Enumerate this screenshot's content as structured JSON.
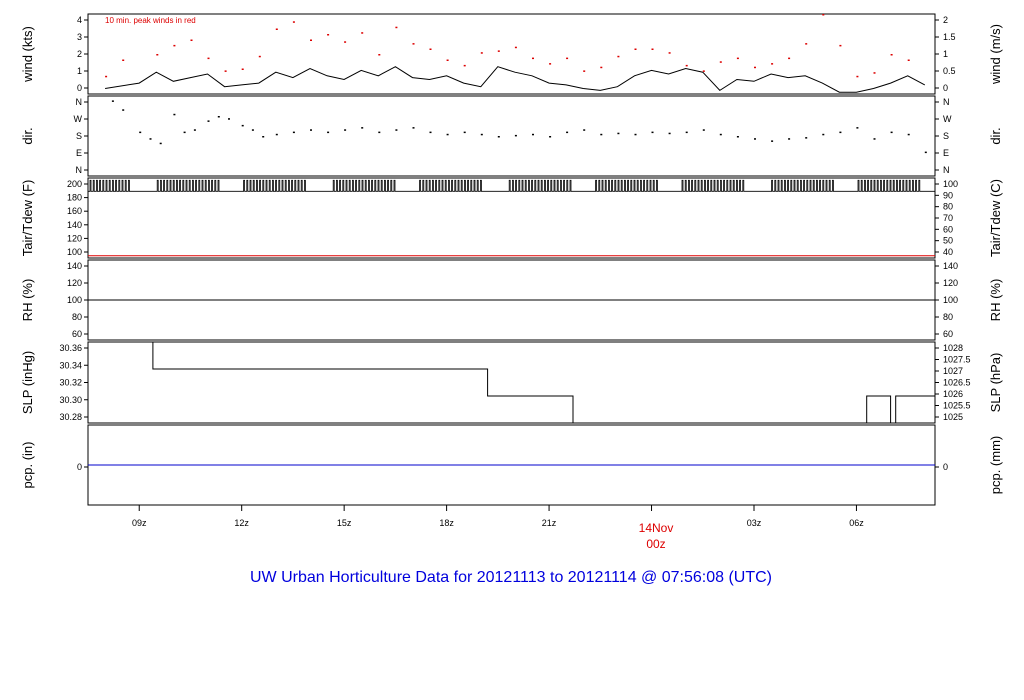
{
  "footer_title": "UW Urban Horticulture Data for 20121113  to  20121114 @ 07:56:08  (UTC)",
  "date_marker": {
    "day": "14Nov",
    "hour": "00z",
    "color": "#dd0000"
  },
  "x_ticks": [
    "09z",
    "12z",
    "15z",
    "18z",
    "21z",
    "00z",
    "03z",
    "06z"
  ],
  "chart_data": [
    {
      "type": "line",
      "id": "wind",
      "annotation": "10 min. peak winds in red",
      "left_label": "wind (kts)",
      "right_label": "wind (m/s)",
      "left_ticks": [
        "0",
        "1",
        "2",
        "3",
        "4"
      ],
      "right_ticks": [
        "0",
        "0.5",
        "1",
        "1.5",
        "2"
      ],
      "ylim": [
        0,
        4.4
      ],
      "series": [
        {
          "color": "#000000",
          "style": "line",
          "x_hours": [
            8,
            9,
            9.5,
            10,
            10.5,
            11,
            11.5,
            12,
            12.5,
            13,
            13.5,
            14,
            14.5,
            15,
            15.5,
            16,
            16.5,
            17,
            17.5,
            18,
            18.5,
            19,
            19.5,
            20,
            20.5,
            21,
            21.5,
            22,
            22.5,
            23,
            23.5,
            24,
            24.5,
            25,
            25.5,
            26,
            26.5,
            27,
            27.5,
            28,
            28.5,
            29,
            29.5,
            30,
            30.5,
            31,
            31.5,
            32
          ],
          "values": [
            0.3,
            0.6,
            1.2,
            0.7,
            0.9,
            1.1,
            0.4,
            0.5,
            0.6,
            1.2,
            0.9,
            1.4,
            1.0,
            0.8,
            1.3,
            1.0,
            1.5,
            0.9,
            0.8,
            1.0,
            0.6,
            0.4,
            1.5,
            1.2,
            1.0,
            0.6,
            0.5,
            0.3,
            0.2,
            0.4,
            1.0,
            1.3,
            1.1,
            1.4,
            1.2,
            0.2,
            0.8,
            0.7,
            1.1,
            0.9,
            1.0,
            0.6,
            0.1,
            0.1,
            0.3,
            0.6,
            1.0,
            0.5
          ]
        },
        {
          "color": "#dd0000",
          "style": "points",
          "x_hours": [
            8,
            8.5,
            9.5,
            10,
            10.5,
            11,
            11.5,
            12,
            12.5,
            13,
            13.5,
            14,
            14.5,
            15,
            15.5,
            16,
            16.5,
            17,
            17.5,
            18,
            18.5,
            19,
            19.5,
            20,
            20.5,
            21,
            21.5,
            22,
            22.5,
            23,
            23.5,
            24,
            24.5,
            25,
            25.5,
            26,
            26.5,
            27,
            27.5,
            28,
            28.5,
            29,
            29.5,
            30,
            30.5,
            31,
            31.5
          ],
          "values": [
            1.0,
            1.9,
            2.2,
            2.7,
            3.0,
            2.0,
            1.3,
            1.4,
            2.1,
            3.6,
            4.0,
            3.0,
            3.3,
            2.9,
            3.4,
            2.2,
            3.7,
            2.8,
            2.5,
            1.9,
            1.6,
            2.3,
            2.4,
            2.6,
            2.0,
            1.7,
            2.0,
            1.3,
            1.5,
            2.1,
            2.5,
            2.5,
            2.3,
            1.6,
            1.3,
            1.8,
            2.0,
            1.5,
            1.7,
            2.0,
            2.8,
            4.4,
            2.7,
            1.0,
            1.2,
            2.2,
            1.9
          ]
        }
      ]
    },
    {
      "type": "scatter",
      "id": "dir",
      "left_label": "dir.",
      "right_label": "dir.",
      "left_ticks": [
        "N",
        "E",
        "S",
        "W",
        "N"
      ],
      "right_ticks": [
        "N",
        "E",
        "S",
        "W",
        "N"
      ],
      "ylim": [
        0,
        360
      ],
      "series": [
        {
          "color": "#000000",
          "style": "points",
          "x_hours": [
            8.2,
            8.5,
            9,
            9.3,
            9.6,
            10,
            10.3,
            10.6,
            11,
            11.3,
            11.6,
            12,
            12.3,
            12.6,
            13,
            13.5,
            14,
            14.5,
            15,
            15.5,
            16,
            16.5,
            17,
            17.5,
            18,
            18.5,
            19,
            19.5,
            20,
            20.5,
            21,
            21.5,
            22,
            22.5,
            23,
            23.5,
            24,
            24.5,
            25,
            25.5,
            26,
            26.5,
            27,
            27.5,
            28,
            28.5,
            29,
            29.5,
            30,
            30.5,
            31,
            31.5,
            32
          ],
          "values": [
            340,
            300,
            200,
            170,
            150,
            280,
            200,
            210,
            250,
            270,
            260,
            230,
            210,
            180,
            190,
            200,
            210,
            200,
            210,
            220,
            200,
            210,
            220,
            200,
            190,
            200,
            190,
            180,
            185,
            190,
            180,
            200,
            210,
            190,
            195,
            190,
            200,
            195,
            200,
            210,
            190,
            180,
            170,
            160,
            170,
            175,
            190,
            200,
            220,
            170,
            200,
            190,
            110
          ]
        }
      ]
    },
    {
      "type": "line",
      "id": "temp",
      "left_label": "Tair/Tdew (F)",
      "right_label": "Tair/Tdew (C)",
      "left_ticks": [
        "100",
        "120",
        "140",
        "160",
        "180",
        "200"
      ],
      "right_ticks": [
        "40",
        "50",
        "60",
        "70",
        "80",
        "90",
        "100"
      ],
      "ylim": [
        100,
        208
      ],
      "series": [
        {
          "color": "#000000",
          "style": "spiky",
          "base": 190,
          "top": 205
        },
        {
          "color": "#dd0000",
          "style": "flat",
          "value": 103
        }
      ]
    },
    {
      "type": "line",
      "id": "rh",
      "left_label": "RH (%)",
      "right_label": "RH (%)",
      "left_ticks": [
        "60",
        "80",
        "100",
        "120",
        "140"
      ],
      "right_ticks": [
        "60",
        "80",
        "100",
        "120",
        "140"
      ],
      "ylim": [
        58,
        142
      ],
      "series": [
        {
          "color": "#000000",
          "style": "flat",
          "value": 100
        }
      ]
    },
    {
      "type": "line",
      "id": "slp",
      "left_label": "SLP (inHg)",
      "right_label": "SLP (hPa)",
      "left_ticks": [
        "30.28",
        "30.30",
        "30.32",
        "30.34",
        "30.36"
      ],
      "right_ticks": [
        "1025",
        "1025.5",
        "1026",
        "1026.5",
        "1027",
        "1027.5",
        "1028"
      ],
      "ylim": [
        30.27,
        30.36
      ],
      "series": [
        {
          "color": "#000000",
          "style": "step",
          "x_hours": [
            7.5,
            9.4,
            9.4,
            19.2,
            19.2,
            21.7,
            21.7,
            30.3,
            30.3,
            31.0,
            31.0,
            31.15,
            31.15,
            32.3
          ],
          "values": [
            30.36,
            30.36,
            30.33,
            30.33,
            30.3,
            30.3,
            30.27,
            30.27,
            30.3,
            30.3,
            30.27,
            30.27,
            30.3,
            30.3
          ]
        }
      ]
    },
    {
      "type": "line",
      "id": "pcp",
      "left_label": "pcp. (in)",
      "right_label": "pcp. (mm)",
      "left_ticks": [
        "0"
      ],
      "right_ticks": [
        "0"
      ],
      "ylim": [
        -1,
        1
      ],
      "series": [
        {
          "color": "#0000cc",
          "style": "flat",
          "value": 0
        }
      ]
    }
  ]
}
